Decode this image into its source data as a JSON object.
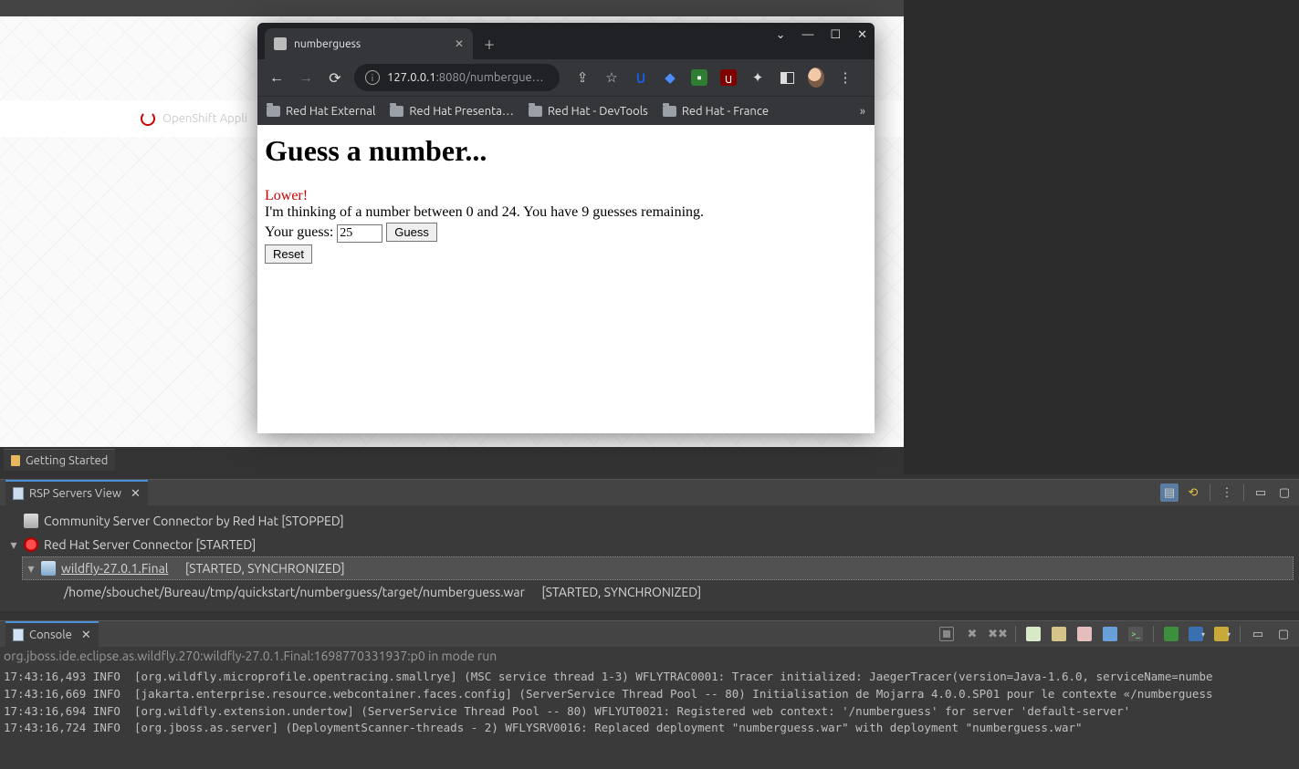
{
  "background": {
    "openshift_label": "OpenShift Appli",
    "editor_tab": "Getting Started"
  },
  "browser": {
    "tab_title": "numberguess",
    "window_controls": {
      "dropdown": "⌄",
      "min": "—",
      "max": "☐",
      "close": "✕"
    },
    "nav": {
      "back": "←",
      "forward": "→",
      "reload": "⟳"
    },
    "omnibox": {
      "host": "127.0.0.1",
      "rest": ":8080/numbergue…"
    },
    "toolbar_icons": {
      "share": "share-icon",
      "star": "star-icon",
      "bitwarden": "U",
      "diamond": "◆",
      "save": "💾",
      "ublock": "uO",
      "extensions": "✦",
      "sidepanel": "panel",
      "avatar": "avatar",
      "menu": "⋮"
    },
    "bookmarks": [
      "Red Hat External",
      "Red Hat Presenta…",
      "Red Hat - DevTools",
      "Red Hat - France"
    ],
    "bookmarks_overflow": "»",
    "page": {
      "heading": "Guess a number...",
      "feedback": "Lower!",
      "instruction": "I'm thinking of a number between 0 and 24. You have 9 guesses remaining.",
      "guess_label": "Your guess: ",
      "guess_value": "25",
      "guess_button": "Guess",
      "reset_button": "Reset"
    }
  },
  "rsp": {
    "view_title": "RSP Servers View",
    "items": {
      "community": "Community Server Connector by Red Hat [STOPPED]",
      "redhat": "Red Hat Server Connector [STARTED]",
      "wildfly_name": "wildfly-27.0.1.Final",
      "wildfly_status": "[STARTED, SYNCHRONIZED]",
      "deployment_path": "/home/sbouchet/Bureau/tmp/quickstart/numberguess/target/numberguess.war",
      "deployment_status": "[STARTED, SYNCHRONIZED]"
    }
  },
  "console": {
    "view_title": "Console",
    "header": "org.jboss.ide.eclipse.as.wildfly.270:wildfly-27.0.1.Final:1698770331937:p0 in mode run",
    "lines": [
      "17:43:16,493 INFO  [org.wildfly.microprofile.opentracing.smallrye] (MSC service thread 1-3) WFLYTRAC0001: Tracer initialized: JaegerTracer(version=Java-1.6.0, serviceName=numbe",
      "17:43:16,669 INFO  [jakarta.enterprise.resource.webcontainer.faces.config] (ServerService Thread Pool -- 80) Initialisation de Mojarra 4.0.0.SP01 pour le contexte «/numberguess",
      "17:43:16,694 INFO  [org.wildfly.extension.undertow] (ServerService Thread Pool -- 80) WFLYUT0021: Registered web context: '/numberguess' for server 'default-server'",
      "17:43:16,724 INFO  [org.jboss.as.server] (DeploymentScanner-threads - 2) WFLYSRV0016: Replaced deployment \"numberguess.war\" with deployment \"numberguess.war\""
    ]
  }
}
